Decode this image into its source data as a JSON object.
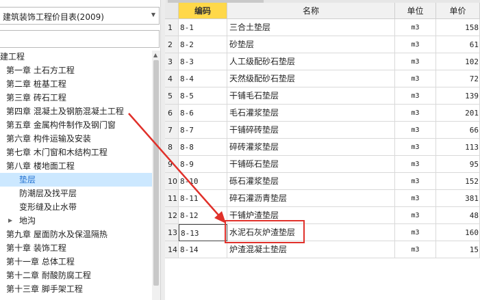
{
  "catalog_selector": {
    "value": "建筑装饰工程价目表(2009)"
  },
  "search": {
    "value": "",
    "placeholder": ""
  },
  "tree": {
    "items": [
      {
        "label": "建工程",
        "level": 0,
        "selected": false,
        "expandable": false
      },
      {
        "label": "第一章 土石方工程",
        "level": 1,
        "selected": false,
        "expandable": false
      },
      {
        "label": "第二章 桩基工程",
        "level": 1,
        "selected": false,
        "expandable": false
      },
      {
        "label": "第三章 砖石工程",
        "level": 1,
        "selected": false,
        "expandable": false
      },
      {
        "label": "第四章 混凝土及钢筋混凝土工程",
        "level": 1,
        "selected": false,
        "expandable": false
      },
      {
        "label": "第五章 金属构件制作及钢门窗",
        "level": 1,
        "selected": false,
        "expandable": false
      },
      {
        "label": "第六章 构件运输及安装",
        "level": 1,
        "selected": false,
        "expandable": false
      },
      {
        "label": "第七章 木门窗和木结构工程",
        "level": 1,
        "selected": false,
        "expandable": false
      },
      {
        "label": "第八章 楼地面工程",
        "level": 1,
        "selected": false,
        "expandable": false
      },
      {
        "label": "垫层",
        "level": 2,
        "selected": true,
        "expandable": false
      },
      {
        "label": "防潮层及找平层",
        "level": 2,
        "selected": false,
        "expandable": false
      },
      {
        "label": "变形缝及止水带",
        "level": 2,
        "selected": false,
        "expandable": false
      },
      {
        "label": "地沟",
        "level": 2,
        "selected": false,
        "expandable": true
      },
      {
        "label": "第九章 屋面防水及保温隔热",
        "level": 1,
        "selected": false,
        "expandable": false
      },
      {
        "label": "第十章 装饰工程",
        "level": 1,
        "selected": false,
        "expandable": false
      },
      {
        "label": "第十一章 总体工程",
        "level": 1,
        "selected": false,
        "expandable": false
      },
      {
        "label": "第十二章 耐酸防腐工程",
        "level": 1,
        "selected": false,
        "expandable": false
      },
      {
        "label": "第十三章 脚手架工程",
        "level": 1,
        "selected": false,
        "expandable": false
      }
    ]
  },
  "grid": {
    "columns": [
      "编码",
      "名称",
      "单位",
      "单价"
    ],
    "active_column": 0,
    "rows": [
      {
        "n": "1",
        "code": "8-1",
        "name": "三合土垫层",
        "unit": "m3",
        "price": "158"
      },
      {
        "n": "2",
        "code": "8-2",
        "name": "砂垫层",
        "unit": "m3",
        "price": "61"
      },
      {
        "n": "3",
        "code": "8-3",
        "name": "人工级配砂石垫层",
        "unit": "m3",
        "price": "102"
      },
      {
        "n": "4",
        "code": "8-4",
        "name": "天然级配砂石垫层",
        "unit": "m3",
        "price": "72"
      },
      {
        "n": "5",
        "code": "8-5",
        "name": "干铺毛石垫层",
        "unit": "m3",
        "price": "139"
      },
      {
        "n": "6",
        "code": "8-6",
        "name": "毛石灌浆垫层",
        "unit": "m3",
        "price": "201"
      },
      {
        "n": "7",
        "code": "8-7",
        "name": "干铺碎砖垫层",
        "unit": "m3",
        "price": "66"
      },
      {
        "n": "8",
        "code": "8-8",
        "name": "碎砖灌浆垫层",
        "unit": "m3",
        "price": "113"
      },
      {
        "n": "9",
        "code": "8-9",
        "name": "干铺砾石垫层",
        "unit": "m3",
        "price": "95"
      },
      {
        "n": "10",
        "code": "8-10",
        "name": "砾石灌浆垫层",
        "unit": "m3",
        "price": "152"
      },
      {
        "n": "11",
        "code": "8-11",
        "name": "碎石灌沥青垫层",
        "unit": "m3",
        "price": "381"
      },
      {
        "n": "12",
        "code": "8-12",
        "name": "干铺炉渣垫层",
        "unit": "m3",
        "price": "48"
      },
      {
        "n": "13",
        "code": "8-13",
        "name": "水泥石灰炉渣垫层",
        "unit": "m3",
        "price": "160"
      },
      {
        "n": "14",
        "code": "8-14",
        "name": "炉渣混凝土垫层",
        "unit": "m3",
        "price": "15"
      }
    ],
    "current_row": 12,
    "highlighted_row": 12
  },
  "annotation": {
    "color": "#e0302a"
  },
  "colors": {
    "selection_bg": "#cce8ff",
    "active_header": "#ffd84a",
    "tree_selected_text": "#1f6fd0"
  },
  "icons": {
    "dropdown": "chevron-down-icon",
    "expander": "triangle-right-icon",
    "scroll_up": "arrow-up-icon"
  }
}
